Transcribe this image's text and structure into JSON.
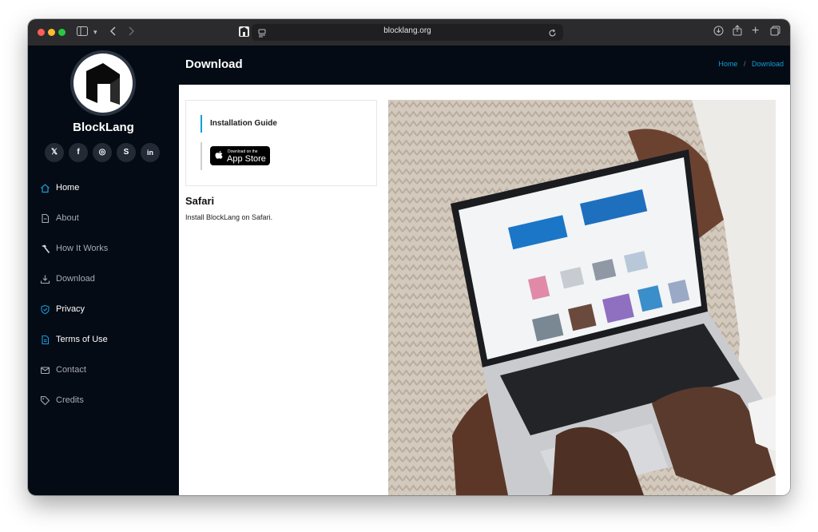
{
  "browser": {
    "url": "blocklang.org"
  },
  "sidebar": {
    "brand": "BlockLang",
    "socials": [
      {
        "icon": "x-icon",
        "glyph": "𝕏"
      },
      {
        "icon": "facebook-icon",
        "glyph": "f"
      },
      {
        "icon": "instagram-icon",
        "glyph": "◎"
      },
      {
        "icon": "skype-icon",
        "glyph": "S"
      },
      {
        "icon": "linkedin-icon",
        "glyph": "in"
      }
    ],
    "items": [
      {
        "label": "Home",
        "icon": "house-icon",
        "active": true
      },
      {
        "label": "About",
        "icon": "file-icon",
        "active": false
      },
      {
        "label": "How It Works",
        "icon": "hammer-icon",
        "active": false
      },
      {
        "label": "Download",
        "icon": "download-icon",
        "active": false
      },
      {
        "label": "Privacy",
        "icon": "shield-icon",
        "active": true
      },
      {
        "label": "Terms of Use",
        "icon": "document-icon",
        "active": true
      },
      {
        "label": "Contact",
        "icon": "envelope-icon",
        "active": false
      },
      {
        "label": "Credits",
        "icon": "tags-icon",
        "active": false
      }
    ]
  },
  "header": {
    "title": "Download",
    "breadcrumb": {
      "home": "Home",
      "separator": "/",
      "current": "Download"
    }
  },
  "main": {
    "guide_label": "Installation Guide",
    "app_store_small": "Download on the",
    "app_store_big": "App Store",
    "section_title": "Safari",
    "section_text": "Install BlockLang on Safari."
  },
  "colors": {
    "accent": "#149ddd",
    "sidebar_bg": "#040b14",
    "active_nav_icon": "#149ddd"
  }
}
